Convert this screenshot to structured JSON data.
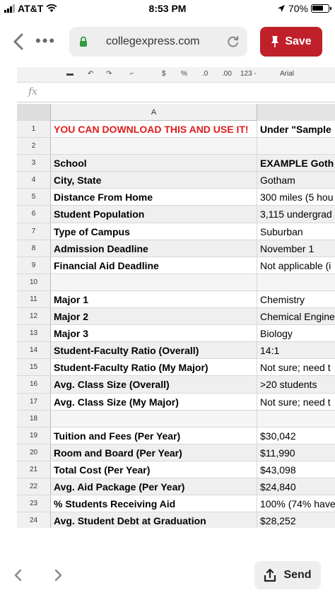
{
  "status": {
    "carrier": "AT&T",
    "time": "8:53 PM",
    "battery": "70%"
  },
  "browser": {
    "url": "collegexpress.com",
    "save_label": "Save",
    "send_label": "Send"
  },
  "sheet": {
    "toolbar": [
      "123 -",
      "Arial"
    ],
    "column_a": "A",
    "rows": [
      {
        "n": "1",
        "a": "YOU CAN DOWNLOAD THIS AND USE IT!",
        "b": "Under \"Sample"
      },
      {
        "n": "2",
        "a": "",
        "b": ""
      },
      {
        "n": "3",
        "a": "School",
        "b": "EXAMPLE Goth"
      },
      {
        "n": "4",
        "a": "City, State",
        "b": "Gotham"
      },
      {
        "n": "5",
        "a": "Distance From Home",
        "b": "300 miles (5 hou"
      },
      {
        "n": "6",
        "a": "Student Population",
        "b": "3,115 undergrad"
      },
      {
        "n": "7",
        "a": "Type of Campus",
        "b": "Suburban"
      },
      {
        "n": "8",
        "a": "Admission Deadline",
        "b": "November 1"
      },
      {
        "n": "9",
        "a": "Financial Aid Deadline",
        "b": "Not applicable (i"
      },
      {
        "n": "10",
        "a": "",
        "b": ""
      },
      {
        "n": "11",
        "a": "Major 1",
        "b": "Chemistry"
      },
      {
        "n": "12",
        "a": "Major 2",
        "b": "Chemical Engine"
      },
      {
        "n": "13",
        "a": "Major 3",
        "b": "Biology"
      },
      {
        "n": "14",
        "a": "Student-Faculty Ratio (Overall)",
        "b": "14:1"
      },
      {
        "n": "15",
        "a": "Student-Faculty Ratio (My Major)",
        "b": "Not sure; need t"
      },
      {
        "n": "16",
        "a": "Avg. Class Size (Overall)",
        "b": ">20 students"
      },
      {
        "n": "17",
        "a": "Avg. Class Size (My Major)",
        "b": "Not sure; need t"
      },
      {
        "n": "18",
        "a": "",
        "b": ""
      },
      {
        "n": "19",
        "a": "Tuition and Fees (Per Year)",
        "b": "$30,042"
      },
      {
        "n": "20",
        "a": "Room and Board (Per Year)",
        "b": "$11,990"
      },
      {
        "n": "21",
        "a": "Total Cost (Per Year)",
        "b": "$43,098"
      },
      {
        "n": "22",
        "a": "Avg. Aid Package (Per Year)",
        "b": "$24,840"
      },
      {
        "n": "23",
        "a": "% Students Receiving Aid",
        "b": "100% (74% have"
      },
      {
        "n": "24",
        "a": "Avg. Student Debt at Graduation",
        "b": "$28,252"
      }
    ]
  },
  "colors": {
    "save_red": "#c0202a",
    "title_red": "#e01b1b"
  }
}
